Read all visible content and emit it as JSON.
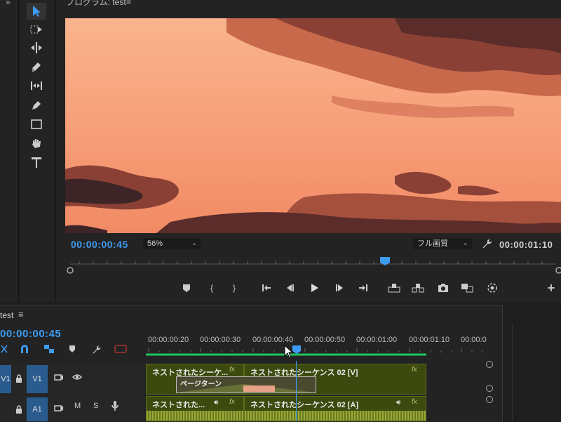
{
  "program": {
    "title": "プログラム: test",
    "timecode_current": "00:00:00:45",
    "zoom": "56%",
    "quality": "フル画質",
    "timecode_duration": "00:00:01:10"
  },
  "tools": [
    "selection-tool",
    "track-select-tool",
    "ripple-edit-tool",
    "razor-tool",
    "slip-tool",
    "pen-tool",
    "rectangle-tool",
    "hand-tool",
    "type-tool"
  ],
  "timeline": {
    "title": "test",
    "timecode": "00:00:00:45",
    "ruler": [
      "00:00:00:20",
      "00:00:00:30",
      "00:00:00:40",
      "00:00:00:50",
      "00:00:01:00",
      "00:00:01:10",
      "00:00:0"
    ],
    "tracks": {
      "v1_label": "V1",
      "v1_target": "V1",
      "a1_label": "A1",
      "mute": "M",
      "solo": "S"
    },
    "clips": {
      "v1_clip1": "ネストされたシーケ...",
      "v1_clip2": "ネストされたシーケンス 02 [V]",
      "transition": "ページターン",
      "a1_clip1": "ネストされた...",
      "a1_clip2": "ネストされたシーケンス 02 [A]",
      "fx": "fx"
    }
  },
  "colors": {
    "accent": "#3d9cf2",
    "clip_video": "#3d4a0f",
    "track_target": "#2a5b8e",
    "work_area": "#22c55e"
  }
}
